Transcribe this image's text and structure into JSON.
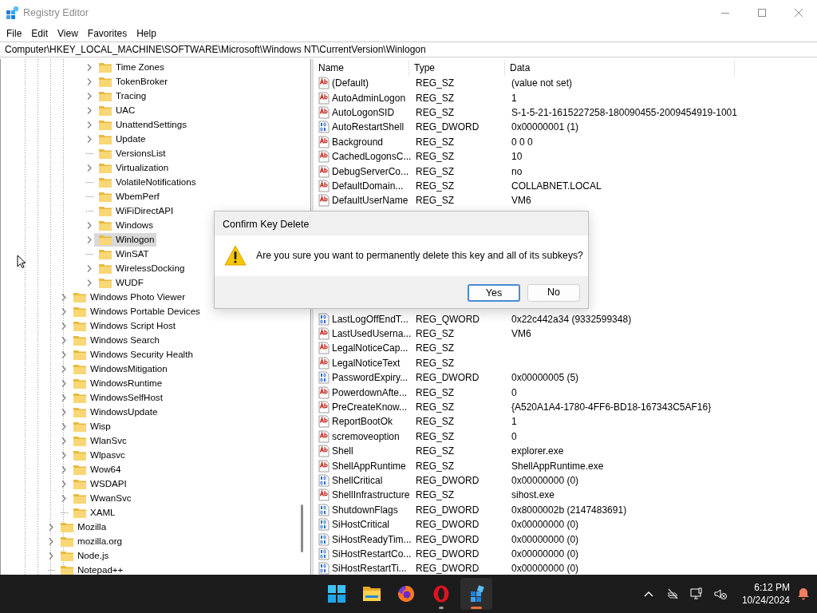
{
  "window": {
    "title": "Registry Editor",
    "active": false
  },
  "menu": [
    "File",
    "Edit",
    "View",
    "Favorites",
    "Help"
  ],
  "address": "Computer\\HKEY_LOCAL_MACHINE\\SOFTWARE\\Microsoft\\Windows NT\\CurrentVersion\\Winlogon",
  "tree": [
    {
      "children": [
        {
          "children": [
            {
              "children": [
                {
                  "label": "Time Zones",
                  "expandable": true,
                  "selected": false
                },
                {
                  "label": "TokenBroker",
                  "expandable": true,
                  "selected": false
                },
                {
                  "label": "Tracing",
                  "expandable": true,
                  "selected": false
                },
                {
                  "label": "UAC",
                  "expandable": true,
                  "selected": false
                },
                {
                  "label": "UnattendSettings",
                  "expandable": true,
                  "selected": false
                },
                {
                  "label": "Update",
                  "expandable": true,
                  "selected": false
                },
                {
                  "label": "VersionsList",
                  "expandable": false,
                  "selected": false
                },
                {
                  "label": "Virtualization",
                  "expandable": true,
                  "selected": false
                },
                {
                  "label": "VolatileNotifications",
                  "expandable": false,
                  "selected": false
                },
                {
                  "label": "WbemPerf",
                  "expandable": false,
                  "selected": false
                },
                {
                  "label": "WiFiDirectAPI",
                  "expandable": false,
                  "selected": false
                },
                {
                  "label": "Windows",
                  "expandable": true,
                  "selected": false
                },
                {
                  "label": "Winlogon",
                  "expandable": true,
                  "selected": true
                },
                {
                  "label": "WinSAT",
                  "expandable": false,
                  "selected": false
                },
                {
                  "label": "WirelessDocking",
                  "expandable": true,
                  "selected": false
                },
                {
                  "label": "WUDF",
                  "expandable": true,
                  "selected": false
                }
              ]
            }
          ]
        },
        {
          "label": "Windows Photo Viewer",
          "expandable": true,
          "selected": false
        },
        {
          "label": "Windows Portable Devices",
          "expandable": true,
          "selected": false
        },
        {
          "label": "Windows Script Host",
          "expandable": true,
          "selected": false
        },
        {
          "label": "Windows Search",
          "expandable": true,
          "selected": false
        },
        {
          "label": "Windows Security Health",
          "expandable": true,
          "selected": false
        },
        {
          "label": "WindowsMitigation",
          "expandable": true,
          "selected": false
        },
        {
          "label": "WindowsRuntime",
          "expandable": true,
          "selected": false
        },
        {
          "label": "WindowsSelfHost",
          "expandable": true,
          "selected": false
        },
        {
          "label": "WindowsUpdate",
          "expandable": true,
          "selected": false
        },
        {
          "label": "Wisp",
          "expandable": true,
          "selected": false
        },
        {
          "label": "WlanSvc",
          "expandable": true,
          "selected": false
        },
        {
          "label": "Wlpasvc",
          "expandable": true,
          "selected": false
        },
        {
          "label": "Wow64",
          "expandable": true,
          "selected": false
        },
        {
          "label": "WSDAPI",
          "expandable": true,
          "selected": false
        },
        {
          "label": "WwanSvc",
          "expandable": true,
          "selected": false
        },
        {
          "label": "XAML",
          "expandable": false,
          "selected": false
        }
      ]
    },
    {
      "label": "Mozilla",
      "expandable": true,
      "selected": false
    },
    {
      "label": "mozilla.org",
      "expandable": true,
      "selected": false
    },
    {
      "label": "Node.js",
      "expandable": true,
      "selected": false
    },
    {
      "label": "Notepad++",
      "expandable": false,
      "selected": false
    }
  ],
  "list": {
    "columns": [
      "Name",
      "Type",
      "Data"
    ],
    "rows_above": [
      {
        "kind": "string",
        "name": "(Default)",
        "type": "REG_SZ",
        "data": "(value not set)"
      },
      {
        "kind": "string",
        "name": "AutoAdminLogon",
        "type": "REG_SZ",
        "data": "1"
      },
      {
        "kind": "string",
        "name": "AutoLogonSID",
        "type": "REG_SZ",
        "data": "S-1-5-21-1615227258-180090455-2009454919-1001"
      },
      {
        "kind": "binary",
        "name": "AutoRestartShell",
        "type": "REG_DWORD",
        "data": "0x00000001 (1)"
      },
      {
        "kind": "string",
        "name": "Background",
        "type": "REG_SZ",
        "data": "0 0 0"
      },
      {
        "kind": "string",
        "name": "CachedLogonsC...",
        "type": "REG_SZ",
        "data": "10"
      },
      {
        "kind": "string",
        "name": "DebugServerCo...",
        "type": "REG_SZ",
        "data": "no"
      },
      {
        "kind": "string",
        "name": "DefaultDomain...",
        "type": "REG_SZ",
        "data": "COLLABNET.LOCAL"
      },
      {
        "kind": "string",
        "name": "DefaultUserName",
        "type": "REG_SZ",
        "data": "VM6"
      }
    ],
    "rows_below": [
      {
        "kind": "binary",
        "name": "LastLogOffEndT...",
        "type": "REG_QWORD",
        "data": "0x22c442a34 (9332599348)"
      },
      {
        "kind": "string",
        "name": "LastUsedUserna...",
        "type": "REG_SZ",
        "data": "VM6"
      },
      {
        "kind": "string",
        "name": "LegalNoticeCap...",
        "type": "REG_SZ"
      },
      {
        "kind": "string",
        "name": "LegalNoticeText",
        "type": "REG_SZ"
      },
      {
        "kind": "binary",
        "name": "PasswordExpiry...",
        "type": "REG_DWORD",
        "data": "0x00000005 (5)"
      },
      {
        "kind": "string",
        "name": "PowerdownAfte...",
        "type": "REG_SZ",
        "data": "0"
      },
      {
        "kind": "string",
        "name": "PreCreateKnow...",
        "type": "REG_SZ",
        "data": "{A520A1A4-1780-4FF6-BD18-167343C5AF16}"
      },
      {
        "kind": "string",
        "name": "ReportBootOk",
        "type": "REG_SZ",
        "data": "1"
      },
      {
        "kind": "string",
        "name": "scremoveoption",
        "type": "REG_SZ",
        "data": "0"
      },
      {
        "kind": "string",
        "name": "Shell",
        "type": "REG_SZ",
        "data": "explorer.exe"
      },
      {
        "kind": "string",
        "name": "ShellAppRuntime",
        "type": "REG_SZ",
        "data": "ShellAppRuntime.exe"
      },
      {
        "kind": "binary",
        "name": "ShellCritical",
        "type": "REG_DWORD",
        "data": "0x00000000 (0)"
      },
      {
        "kind": "string",
        "name": "ShellInfrastructure",
        "type": "REG_SZ",
        "data": "sihost.exe"
      },
      {
        "kind": "binary",
        "name": "ShutdownFlags",
        "type": "REG_DWORD",
        "data": "0x8000002b (2147483691)"
      },
      {
        "kind": "binary",
        "name": "SiHostCritical",
        "type": "REG_DWORD",
        "data": "0x00000000 (0)"
      },
      {
        "kind": "binary",
        "name": "SiHostReadyTim...",
        "type": "REG_DWORD",
        "data": "0x00000000 (0)"
      },
      {
        "kind": "binary",
        "name": "SiHostRestartCo...",
        "type": "REG_DWORD",
        "data": "0x00000000 (0)"
      },
      {
        "kind": "binary",
        "name": "SiHostRestartTi...",
        "type": "REG_DWORD",
        "data": "0x00000000 (0)"
      }
    ]
  },
  "dialog": {
    "title": "Confirm Key Delete",
    "message": "Are you sure you want to permanently delete this key and all of its subkeys?",
    "buttons": [
      {
        "label": "Yes",
        "default": true
      },
      {
        "label": "No",
        "default": false
      }
    ]
  },
  "taskbar": {
    "apps": [
      {
        "kind": "start",
        "running": false,
        "active": false
      },
      {
        "kind": "folder",
        "running": false,
        "active": false
      },
      {
        "kind": "firefox",
        "running": false,
        "active": false
      },
      {
        "kind": "opera",
        "running": true,
        "active": false
      },
      {
        "kind": "regedit",
        "running": true,
        "active": true
      }
    ],
    "tray": [
      {
        "kind": "chevron"
      },
      {
        "kind": "network"
      },
      {
        "kind": "monitor"
      },
      {
        "kind": "volume_muted"
      }
    ],
    "time": "6:12 PM",
    "date": "10/24/2024"
  }
}
